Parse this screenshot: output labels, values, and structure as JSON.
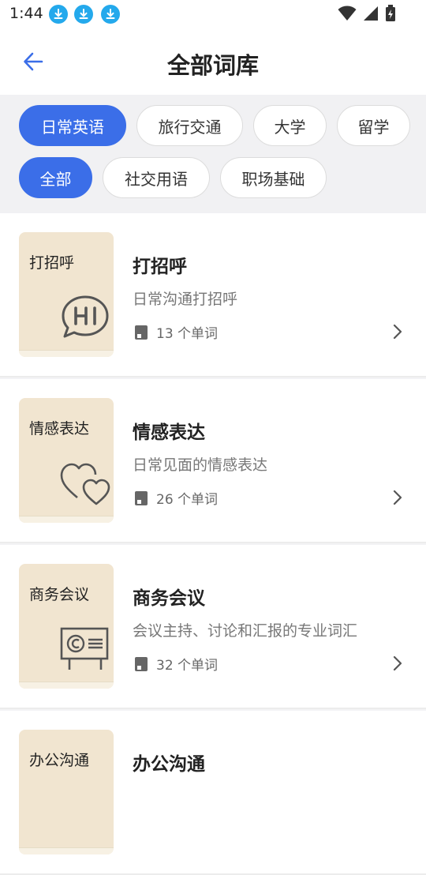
{
  "status": {
    "time": "1:44"
  },
  "header": {
    "title": "全部词库"
  },
  "filters": {
    "row1": [
      {
        "label": "日常英语",
        "active": true
      },
      {
        "label": "旅行交通",
        "active": false
      },
      {
        "label": "大学",
        "active": false
      },
      {
        "label": "留学",
        "active": false
      }
    ],
    "row2": [
      {
        "label": "全部",
        "active": true
      },
      {
        "label": "社交用语",
        "active": false
      },
      {
        "label": "职场基础",
        "active": false
      }
    ]
  },
  "items": [
    {
      "cover_label": "打招呼",
      "title": "打招呼",
      "desc": "日常沟通打招呼",
      "count": "13 个单词",
      "art": "hi-speech-icon"
    },
    {
      "cover_label": "情感表达",
      "title": "情感表达",
      "desc": "日常见面的情感表达",
      "count": "26 个单词",
      "art": "hearts-icon"
    },
    {
      "cover_label": "商务会议",
      "title": "商务会议",
      "desc": "会议主持、讨论和汇报的专业词汇",
      "count": "32 个单词",
      "art": "presentation-board-icon"
    },
    {
      "cover_label": "办公沟通",
      "title": "办公沟通",
      "desc": "",
      "count": "",
      "art": ""
    }
  ],
  "colors": {
    "accent": "#3b6ee8",
    "cover": "#f1e5d0"
  }
}
